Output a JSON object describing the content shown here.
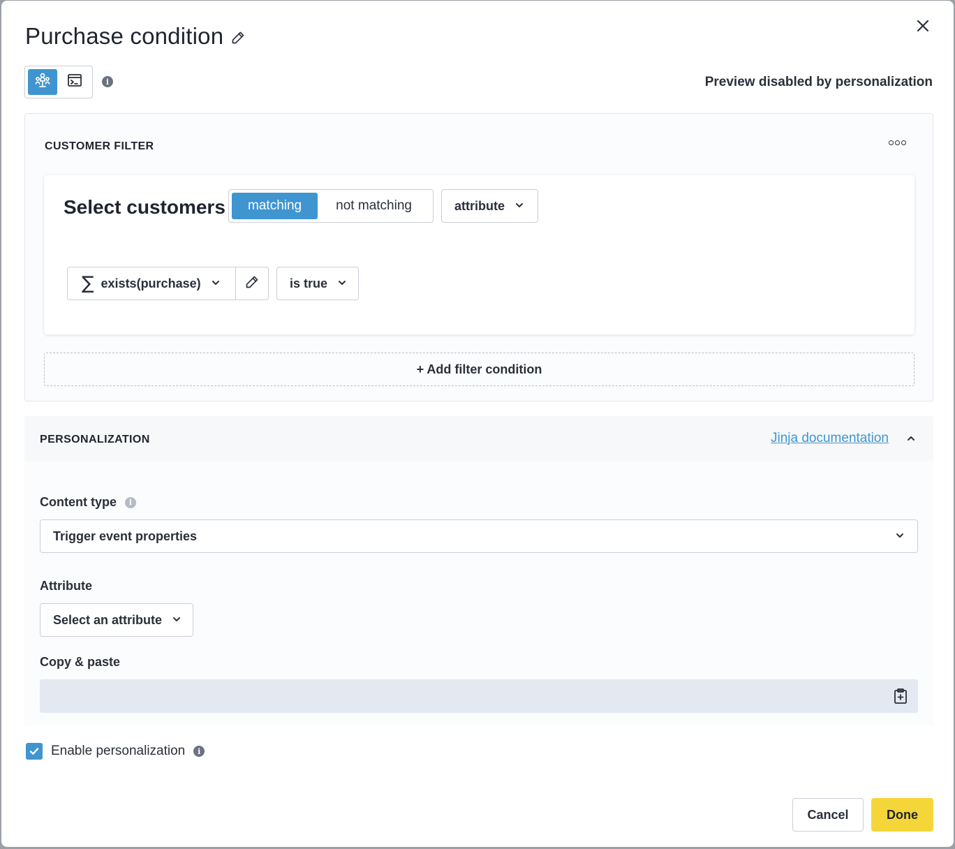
{
  "dialog": {
    "title": "Purchase condition",
    "preview_status": "Preview disabled by personalization"
  },
  "mode_toggle": {
    "options": [
      {
        "name": "visual-builder",
        "icon": "people-network-icon",
        "active": true
      },
      {
        "name": "code-editor",
        "icon": "terminal-icon",
        "active": false
      }
    ]
  },
  "customer_filter": {
    "section_label": "CUSTOMER FILTER",
    "heading": "Select customers",
    "match_options": [
      "matching",
      "not matching"
    ],
    "selected_match": "matching",
    "type_dropdown": "attribute",
    "condition": {
      "attribute": "exists(purchase)",
      "operator": "is true"
    },
    "add_condition_label": "+ Add filter condition"
  },
  "personalization": {
    "section_label": "PERSONALIZATION",
    "doc_link": "Jinja documentation",
    "content_type_label": "Content type",
    "content_type_value": "Trigger event properties",
    "attribute_label": "Attribute",
    "attribute_placeholder": "Select an attribute",
    "copy_label": "Copy & paste",
    "copy_value": ""
  },
  "enable_personalization": {
    "label": "Enable personalization",
    "checked": true
  },
  "footer": {
    "cancel_label": "Cancel",
    "done_label": "Done"
  },
  "colors": {
    "accent": "#3f95cf",
    "primary_button": "#f5d638"
  }
}
